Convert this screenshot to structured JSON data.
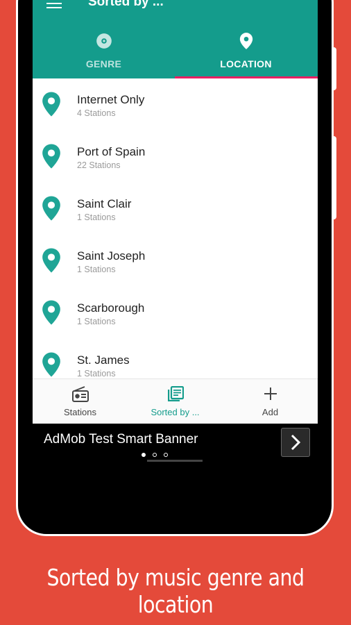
{
  "appbar": {
    "title": "Sorted by ..."
  },
  "tabs": [
    {
      "label": "GENRE",
      "icon": "disc-icon",
      "active": false
    },
    {
      "label": "LOCATION",
      "icon": "location-pin-icon",
      "active": true
    }
  ],
  "locations": [
    {
      "name": "Internet Only",
      "count": "4 Stations"
    },
    {
      "name": "Port of Spain",
      "count": "22 Stations"
    },
    {
      "name": "Saint Clair",
      "count": "1 Stations"
    },
    {
      "name": "Saint Joseph",
      "count": "1 Stations"
    },
    {
      "name": "Scarborough",
      "count": "1 Stations"
    },
    {
      "name": "St. James",
      "count": "1 Stations"
    }
  ],
  "bottom_nav": [
    {
      "label": "Stations",
      "icon": "radio-icon",
      "active": false
    },
    {
      "label": "Sorted by ...",
      "icon": "library-books-icon",
      "active": true
    },
    {
      "label": "Add",
      "icon": "plus-icon",
      "active": false
    }
  ],
  "ad": {
    "text": "AdMob Test Smart Banner"
  },
  "caption": "Sorted by music genre and location",
  "colors": {
    "background": "#E44A3A",
    "primary": "#149C8C",
    "accent": "#E91E63",
    "pin": "#1FA596"
  }
}
